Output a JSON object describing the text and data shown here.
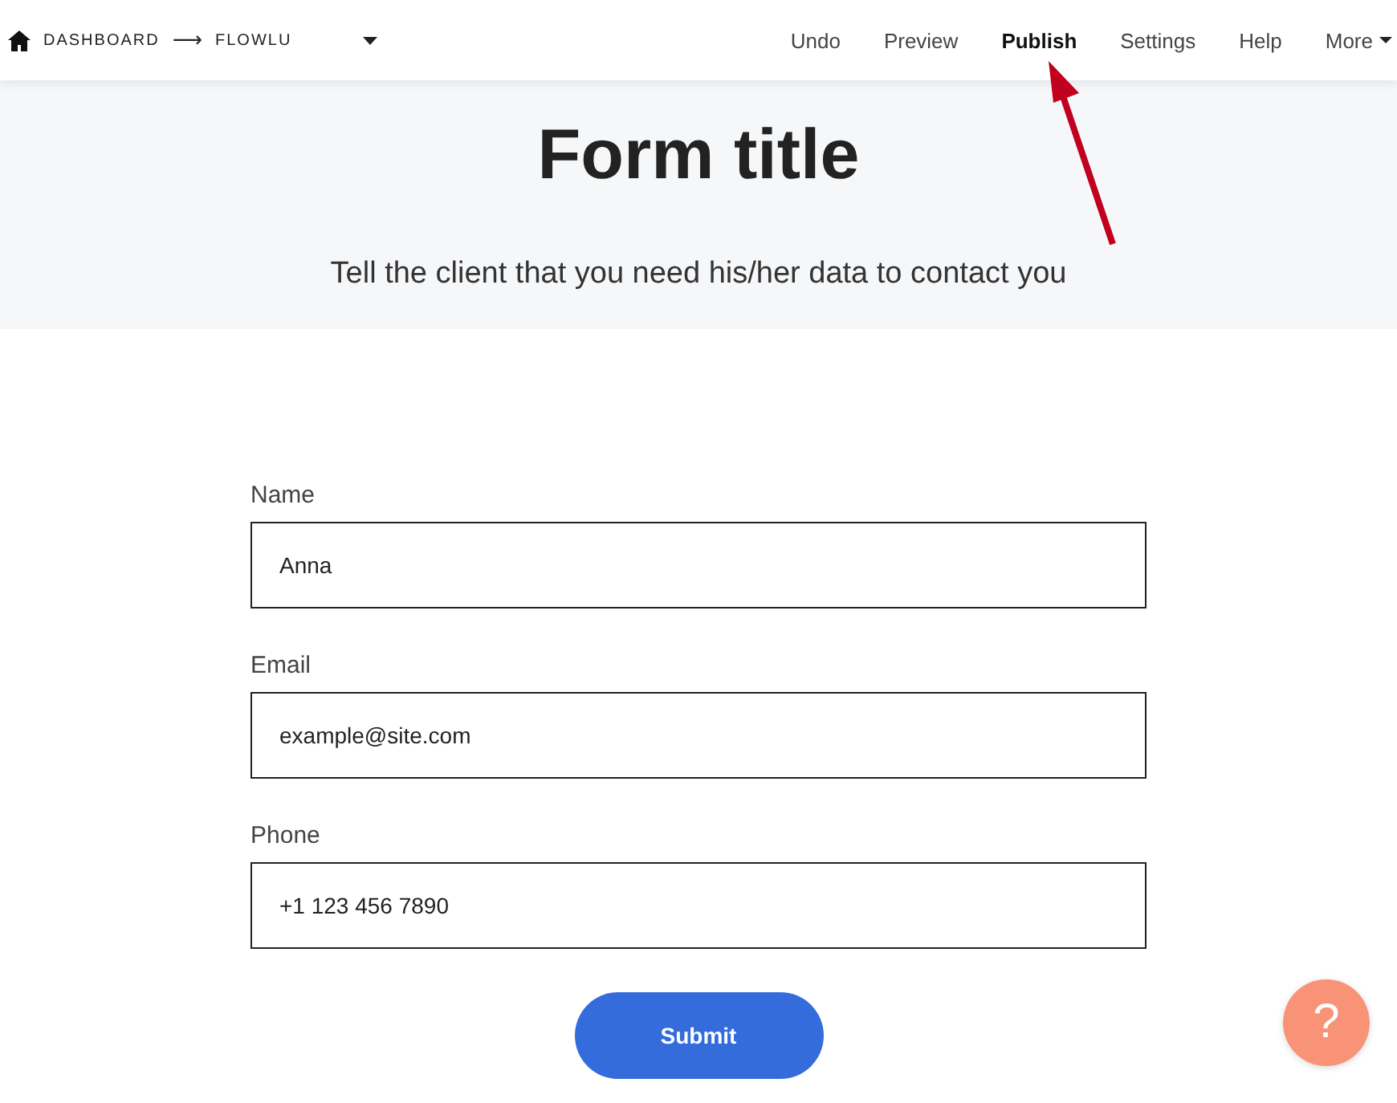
{
  "breadcrumb": {
    "items": [
      "DASHBOARD",
      "FLOWLU"
    ],
    "separator": "⟶"
  },
  "menu": [
    {
      "label": "Undo",
      "selected": false
    },
    {
      "label": "Preview",
      "selected": false
    },
    {
      "label": "Publish",
      "selected": true
    },
    {
      "label": "Settings",
      "selected": false
    },
    {
      "label": "Help",
      "selected": false
    },
    {
      "label": "More",
      "selected": false,
      "dropdown": true
    }
  ],
  "header": {
    "title": "Form title",
    "subtitle": "Tell the client that you need his/her data to contact you"
  },
  "fields": [
    {
      "label": "Name",
      "value": "Anna"
    },
    {
      "label": "Email",
      "value": "example@site.com"
    },
    {
      "label": "Phone",
      "value": "+1 123 456 7890"
    }
  ],
  "submit": "Submit",
  "help_button": "?"
}
